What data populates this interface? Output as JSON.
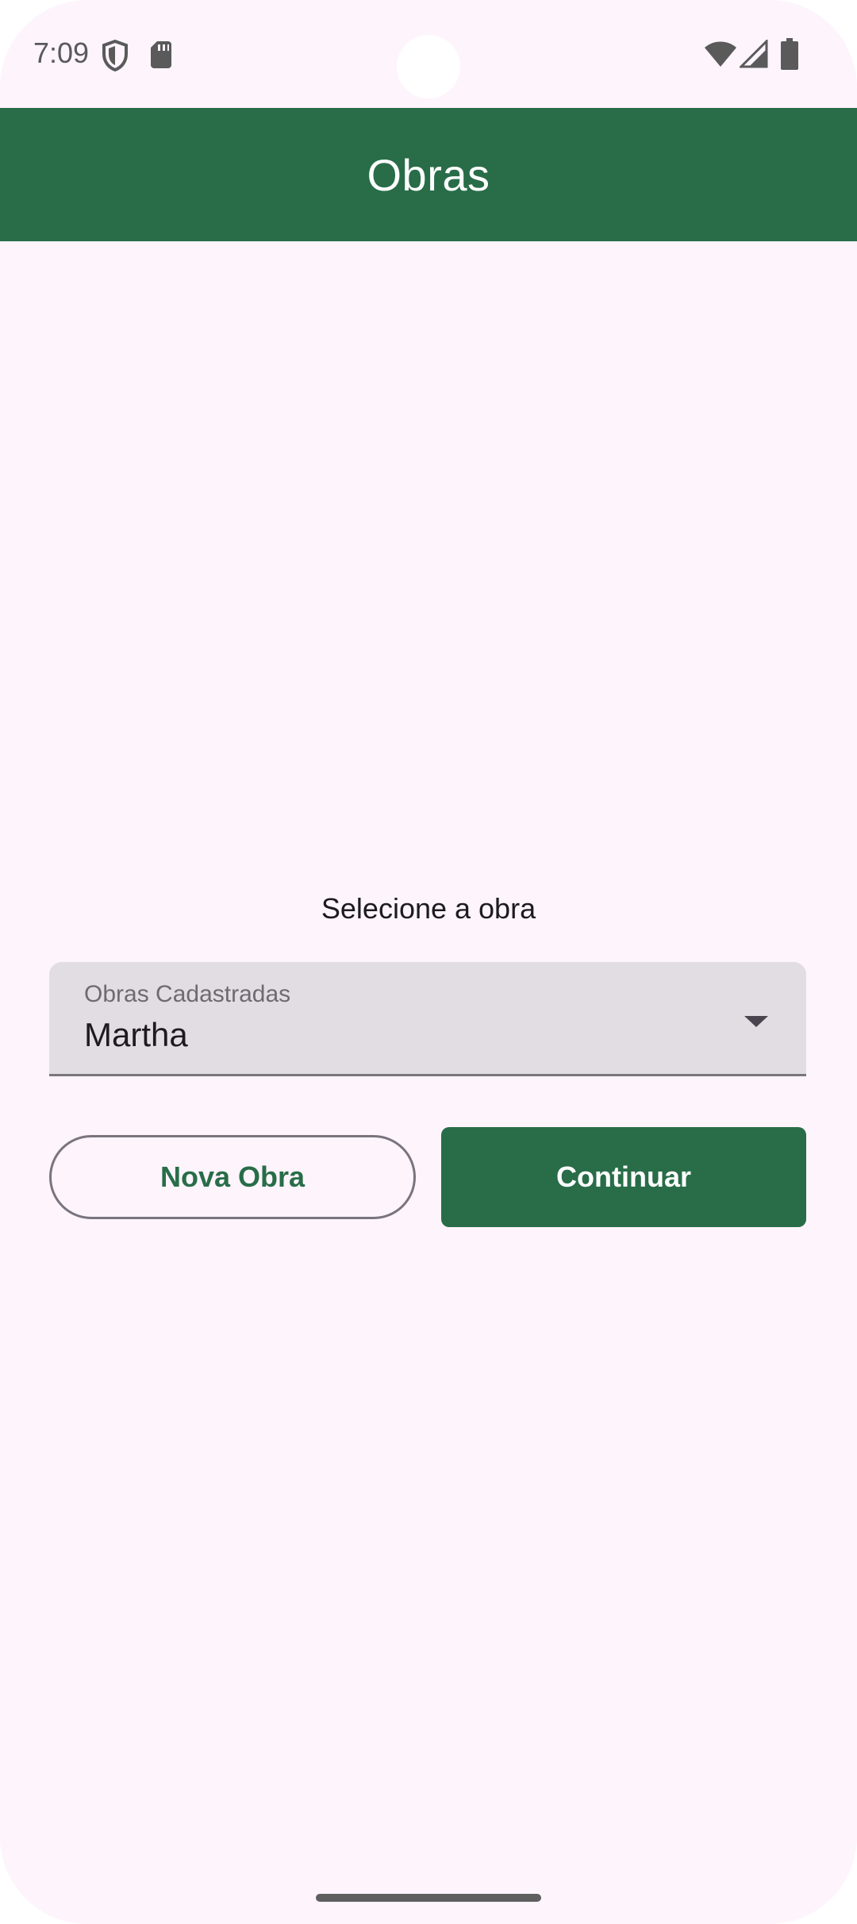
{
  "status_bar": {
    "time": "7:09",
    "icons": [
      "shield-icon",
      "sd-card-icon",
      "wifi-icon",
      "signal-icon",
      "battery-icon"
    ]
  },
  "app_bar": {
    "title": "Obras",
    "color": "#286d48"
  },
  "main": {
    "prompt": "Selecione a obra",
    "dropdown": {
      "label": "Obras Cadastradas",
      "value": "Martha"
    },
    "buttons": {
      "new_label": "Nova Obra",
      "continue_label": "Continuar"
    }
  },
  "colors": {
    "primary": "#286d48",
    "background": "#fdf4fc",
    "field_background": "#e2dde3"
  }
}
